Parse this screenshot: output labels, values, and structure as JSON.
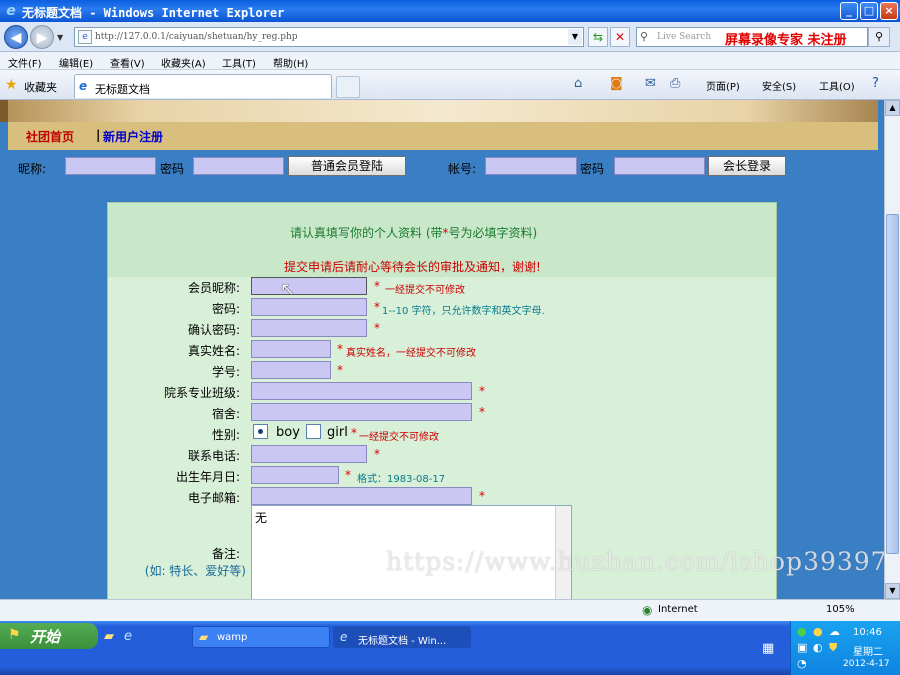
{
  "window": {
    "title": "无标题文档 - Windows Internet Explorer",
    "minimize": "_",
    "maximize": "□",
    "close": "×"
  },
  "address": {
    "url": "http://127.0.0.1/caiyuan/shetuan/hy_reg.php",
    "search_placeholder": "Live Search",
    "watermark_text": "屏幕录像专家 未注册"
  },
  "menu": [
    "文件(F)",
    "编辑(E)",
    "查看(V)",
    "收藏夹(A)",
    "工具(T)",
    "帮助(H)"
  ],
  "favorites": {
    "label": "收藏夹",
    "tab_title": "无标题文档",
    "commands": [
      "页面(P)",
      "安全(S)",
      "工具(O)"
    ]
  },
  "site": {
    "nav_home": "社团首页",
    "nav_sep": "|",
    "nav_register": "新用户注册",
    "login": {
      "nickname_label": "昵称:",
      "password_label": "密码",
      "member_login_button": "普通会员登陆",
      "account_label": "帐号:",
      "password2_label": "密码",
      "president_login_button": "会长登录"
    }
  },
  "form": {
    "header_line1_pre": "请认真填写你的个人资料 (带",
    "header_line1_star": "*",
    "header_line1_post": "号为必填字资料)",
    "header_line2": "提交申请后请耐心等待会长的审批及通知，谢谢!",
    "fields": {
      "nickname": "会员昵称:",
      "password": "密码:",
      "confirm": "确认密码:",
      "realname": "真实姓名:",
      "student_id": "学号:",
      "department": "院系专业班级:",
      "dorm": "宿舍:",
      "gender": "性别:",
      "phone": "联系电话:",
      "birthday": "出生年月日:",
      "email": "电子邮箱:",
      "remark": "备注:",
      "remark_hint": "(如: 特长、爱好等)"
    },
    "notes": {
      "req": "*",
      "nickname_note": "一经提交不可修改",
      "password_note": "1--10 字符，只允许数字和英文字母.",
      "realname_note": "真实姓名，一经提交不可修改",
      "gender_note": "一经提交不可修改",
      "birthday_note": "格式：1983-08-17"
    },
    "gender_options": [
      "boy",
      "girl"
    ],
    "remark_value": "无"
  },
  "overlay_watermark": "https://www.huzhan.com/ishop39397",
  "status": {
    "zone": "Internet",
    "zoom": "105%"
  },
  "taskbar": {
    "start": "开始",
    "items": [
      "wamp",
      "无标题文档 - Win..."
    ],
    "time": "10:46",
    "day": "星期二",
    "date": "2012-4-17"
  }
}
